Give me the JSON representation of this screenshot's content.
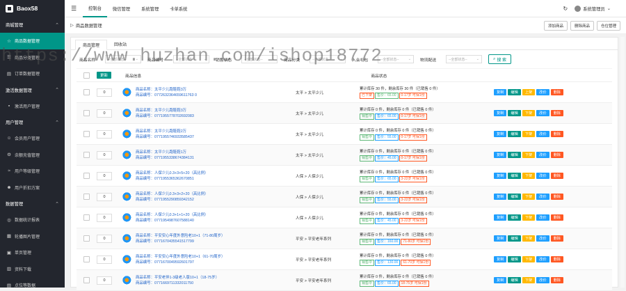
{
  "app": {
    "title": "Baox58"
  },
  "sidebar": [
    {
      "type": "group",
      "label": "商城管理",
      "chev": "⌃"
    },
    {
      "type": "item",
      "label": "商品数据管理",
      "icon": "☆",
      "active": true
    },
    {
      "type": "item",
      "label": "商品分类管理",
      "icon": "☰"
    },
    {
      "type": "item",
      "label": "订单数据管理",
      "icon": "▤"
    },
    {
      "type": "group",
      "label": "激活数据管理",
      "chev": "⌃"
    },
    {
      "type": "item",
      "label": "激活用户管理",
      "icon": "▪"
    },
    {
      "type": "group",
      "label": "用户管理",
      "chev": "⌃"
    },
    {
      "type": "item",
      "label": "会员用户管理",
      "icon": "☺"
    },
    {
      "type": "item",
      "label": "余额充值管理",
      "icon": "⚙"
    },
    {
      "type": "item",
      "label": "用户等级管理",
      "icon": "≈"
    },
    {
      "type": "item",
      "label": "用户折扣方案",
      "icon": "☻"
    },
    {
      "type": "group",
      "label": "数据管理",
      "chev": "⌃"
    },
    {
      "type": "item",
      "label": "数据统计报表",
      "icon": "◎"
    },
    {
      "type": "item",
      "label": "轮播图片管理",
      "icon": "▦"
    },
    {
      "type": "item",
      "label": "单页管理",
      "icon": "▣"
    },
    {
      "type": "item",
      "label": "资料下载",
      "icon": "▥"
    },
    {
      "type": "item",
      "label": "点位等数据",
      "icon": "▤"
    }
  ],
  "topbar": {
    "tabs": [
      "控制台",
      "微信管理",
      "系统管理",
      "卡单系统"
    ],
    "user": "系统管理员"
  },
  "crumb": {
    "text": "商品数据管理",
    "buttons": [
      "添加商品",
      "删除商品",
      "仓位管理"
    ]
  },
  "panel": {
    "tabs": [
      "商品管理",
      "回收站"
    ]
  },
  "filters": [
    {
      "label": "商品名称",
      "ph": "--全部状态--"
    },
    {
      "label": "商品编号",
      "ph": "--全部状态--"
    },
    {
      "label": "销售状态",
      "ph": "--全部状态--"
    },
    {
      "label": "商品分类",
      "ph": "--全部状态--"
    },
    {
      "label": "入会礼包",
      "ph": "--全部状态--"
    },
    {
      "label": "物流配送",
      "ph": "--全部状态--"
    }
  ],
  "search_label": "搜 索",
  "table": {
    "update": "更新",
    "col_info": "商品信息",
    "col_stock": "商品状态"
  },
  "watermark": "https://www.huzhan.com/ishop18772",
  "rows": [
    {
      "qty": "0",
      "name": "商品名称：太平少儿跑鞋鞋3万",
      "code": "商品编号：0772632364659611763 0",
      "cat": "太平 > 太平少儿",
      "stock": "累计库存 30 件，剩余库存 30 件（已销售 0 件）",
      "tags": [
        {
          "t": "已下架",
          "c": "r"
        },
        {
          "t": "售价：65.00",
          "c": "g"
        },
        {
          "t": "0-17岁 可保1份",
          "c": "r"
        }
      ],
      "ops": [
        "复制",
        "编辑",
        "上架",
        "改价",
        "删除"
      ]
    },
    {
      "qty": "0",
      "name": "商品名称：太平少儿跑鞋鞋3万",
      "code": "商品编号：0771955778702692083",
      "cat": "太平 > 太平少儿",
      "stock": "累计库存 0 件，剩余库存 0 件（已销售 0 件）",
      "tags": [
        {
          "t": "销售中",
          "c": "g"
        },
        {
          "t": "售价：65.00",
          "c": "b"
        },
        {
          "t": "0-17岁 可保1份",
          "c": "r"
        }
      ],
      "ops": [
        "复制",
        "编辑",
        "下架",
        "改价",
        "删除"
      ]
    },
    {
      "qty": "0",
      "name": "商品名称：太平少儿跑鞋鞋2万",
      "code": "商品编号：0771955746933585437",
      "cat": "太平 > 太平少儿",
      "stock": "累计库存 0 件，剩余库存 0 件（已销售 0 件）",
      "tags": [
        {
          "t": "销售中",
          "c": "g"
        },
        {
          "t": "售价：55.00",
          "c": "b"
        },
        {
          "t": "0-17岁 可保1份",
          "c": "r"
        }
      ],
      "ops": [
        "复制",
        "编辑",
        "下架",
        "改价",
        "删除"
      ]
    },
    {
      "qty": "0",
      "name": "商品名称：太平少儿跑鞋鞋1万",
      "code": "商品编号：0771955338674384131",
      "cat": "太平 > 太平少儿",
      "stock": "累计库存 0 件，剩余库存 0 件（已销售 0 件）",
      "tags": [
        {
          "t": "销售中",
          "c": "g"
        },
        {
          "t": "售价：45.00",
          "c": "b"
        },
        {
          "t": "0-17岁 可保1份",
          "c": "r"
        }
      ],
      "ops": [
        "复制",
        "编辑",
        "下架",
        "改价",
        "删除"
      ]
    },
    {
      "qty": "0",
      "name": "商品名称：人保少儿0.3+3+5+20（高比例）",
      "code": "商品编号：0771955365362670851",
      "cat": "人保 > 人保少儿",
      "stock": "累计库存 0 件，剩余库存 0 件（已销售 0 件）",
      "tags": [
        {
          "t": "销售中",
          "c": "g"
        },
        {
          "t": "售价：65.00",
          "c": "b"
        },
        {
          "t": "3-22岁 可保1份",
          "c": "r"
        }
      ],
      "ops": [
        "复制",
        "编辑",
        "下架",
        "改价",
        "删除"
      ]
    },
    {
      "qty": "0",
      "name": "商品名称：人保少儿0.3+3+2+20（高比例）",
      "code": "商品编号：0771955290859342152",
      "cat": "人保 > 人保少儿",
      "stock": "累计库存 0 件，剩余库存 0 件（已销售 0 件）",
      "tags": [
        {
          "t": "销售中",
          "c": "g"
        },
        {
          "t": "售价：55.00",
          "c": "b"
        },
        {
          "t": "3-22岁 可保1份",
          "c": "r"
        }
      ],
      "ops": [
        "复制",
        "编辑",
        "下架",
        "改价",
        "删除"
      ]
    },
    {
      "qty": "0",
      "name": "商品名称：人保少儿0.3+1+1+20（高比例）",
      "code": "商品编号：0771954987607588140",
      "cat": "人保 > 人保少儿",
      "stock": "累计库存 0 件，剩余库存 0 件（已销售 0 件）",
      "tags": [
        {
          "t": "销售中",
          "c": "g"
        },
        {
          "t": "售价：45.00",
          "c": "b"
        },
        {
          "t": "3-22岁 可保1份",
          "c": "r"
        }
      ],
      "ops": [
        "复制",
        "编辑",
        "下架",
        "改价",
        "删除"
      ]
    },
    {
      "qty": "0",
      "name": "商品名称：平安安心年度外意险老10+1（71-80周岁）",
      "code": "商品编号：0771670435541517799",
      "cat": "平安 > 平安老年系列",
      "stock": "累计库存 0 件，剩余库存 0 件（已销售 0 件）",
      "tags": [
        {
          "t": "销售中",
          "c": "g"
        },
        {
          "t": "售价：160.00",
          "c": "b"
        },
        {
          "t": "71-80岁 可保1份",
          "c": "r"
        }
      ],
      "ops": [
        "复制",
        "编辑",
        "下架",
        "改价",
        "删除"
      ]
    },
    {
      "qty": "0",
      "name": "商品名称：平安安心年度外意险老10+1（61-70周岁）",
      "code": "商品编号：0771670049592601797",
      "cat": "平安 > 平安老年系列",
      "stock": "累计库存 0 件，剩余库存 0 件（已销售 0 件）",
      "tags": [
        {
          "t": "销售中",
          "c": "g"
        },
        {
          "t": "售价：130.00",
          "c": "b"
        },
        {
          "t": "61-70岁 可保1份",
          "c": "r"
        }
      ],
      "ops": [
        "复制",
        "编辑",
        "下架",
        "改价",
        "删除"
      ]
    },
    {
      "qty": "0",
      "name": "商品名称：平安老伴1-3级老人版10+1（18-75岁）",
      "code": "商品编号：0771669711332011750",
      "cat": "平安 > 平安老年系列",
      "stock": "累计库存 0 件，剩余库存 0 件（已销售 0 件）",
      "tags": [
        {
          "t": "销售中",
          "c": "g"
        },
        {
          "t": "售价：65.00",
          "c": "b"
        },
        {
          "t": "18-75岁 可保1份",
          "c": "r"
        }
      ],
      "ops": [
        "复制",
        "编辑",
        "下架",
        "改价",
        "删除"
      ]
    }
  ]
}
